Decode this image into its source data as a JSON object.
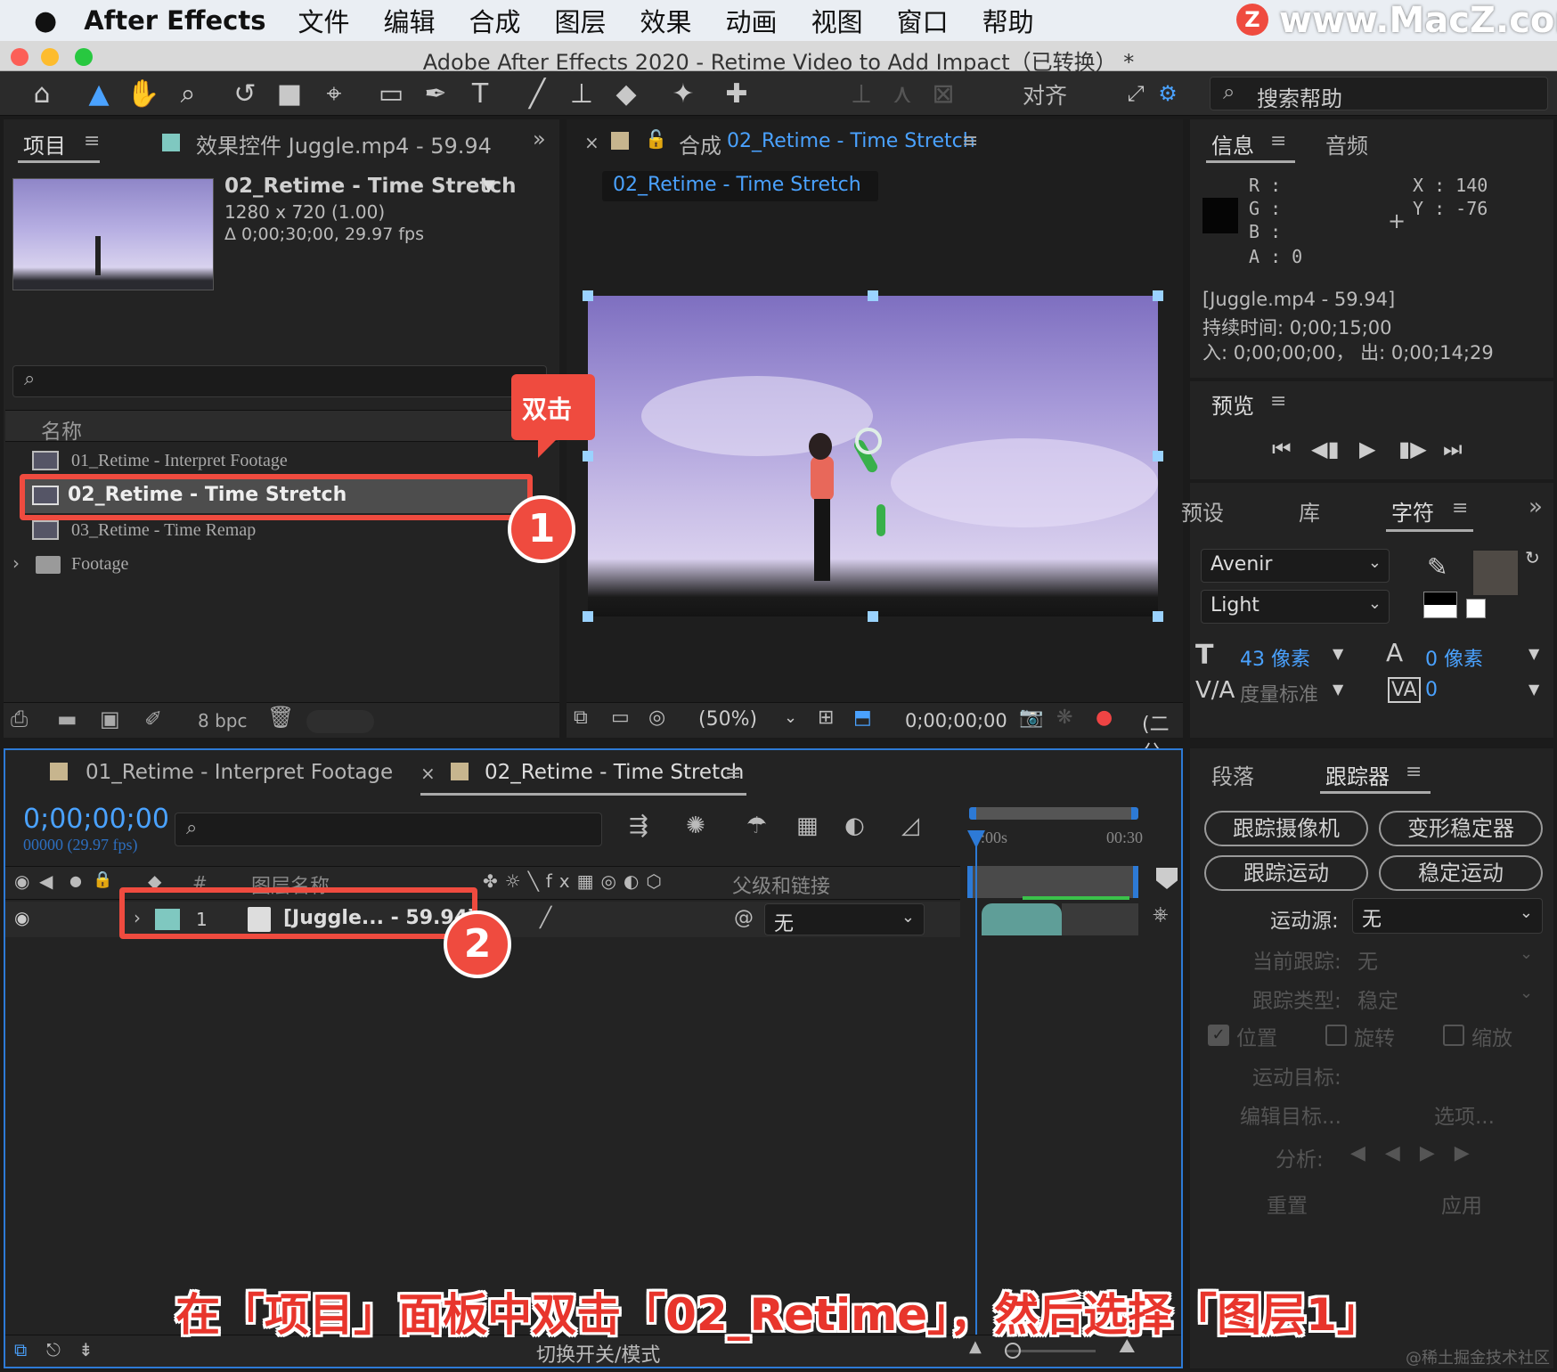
{
  "menubar": {
    "app_name": "After Effects",
    "items": [
      "文件",
      "编辑",
      "合成",
      "图层",
      "效果",
      "动画",
      "视图",
      "窗口",
      "帮助"
    ],
    "watermark": "www.MacZ.com"
  },
  "window": {
    "title": "Adobe After Effects 2020 - Retime Video to Add Impact（已转换） *"
  },
  "toolbar": {
    "align_label": "对齐",
    "search_help_placeholder": "搜索帮助"
  },
  "project_panel": {
    "tab_project": "项目",
    "tab_effects": "效果控件 Juggle.mp4 - 59.94",
    "comp_name": "02_Retime - Time Stretch",
    "comp_res": "1280 x 720 (1.00)",
    "comp_dur": "Δ 0;00;30;00, 29.97 fps",
    "column_name": "名称",
    "items": [
      {
        "label": "01_Retime - Interpret Footage"
      },
      {
        "label": "02_Retime - Time Stretch"
      },
      {
        "label": "03_Retime - Time Remap"
      },
      {
        "label": "Footage"
      }
    ],
    "bpc": "8 bpc"
  },
  "comp_panel": {
    "tab_prefix": "合成",
    "tab_name": "02_Retime - Time Stretch",
    "flow_tab": "02_Retime - Time Stretch",
    "zoom": "(50%)",
    "timecode": "0;00;00;00",
    "resolution": "(二分"
  },
  "info_panel": {
    "tab_info": "信息",
    "tab_audio": "音频",
    "r_label": "R :",
    "g_label": "G :",
    "b_label": "B :",
    "a_label": "A :  0",
    "x_label": "X : 140",
    "y_label": "Y : -76",
    "clip_name": "[Juggle.mp4 - 59.94]",
    "duration": "持续时间: 0;00;15;00",
    "in_out": "入: 0;00;00;00，  出: 0;00;14;29"
  },
  "preview_panel": {
    "title": "预览"
  },
  "character_panel": {
    "tab_presets": "预设",
    "tab_library": "库",
    "tab_character": "字符",
    "font_family": "Avenir",
    "font_style": "Light",
    "font_size": "43 像素",
    "leading": "0 像素",
    "kerning": "度量标准",
    "tracking": "0"
  },
  "timeline": {
    "tab_1": "01_Retime - Interpret Footage",
    "tab_2": "02_Retime - Time Stretch",
    "timecode": "0;00;00;00",
    "fps_line": "00000 (29.97 fps)",
    "col_layer_name": "图层名称",
    "col_hash": "#",
    "col_parent": "父级和链接",
    "layer_number": "1",
    "layer_name": "[Juggle... - 59.94]",
    "parent_value": "无",
    "ruler_start": "0:00s",
    "ruler_end": "00:30",
    "footer_toggle": "切换开关/模式"
  },
  "tracker_panel": {
    "tab_paragraph": "段落",
    "tab_tracker": "跟踪器",
    "btn_track_camera": "跟踪摄像机",
    "btn_warp_stabilizer": "变形稳定器",
    "btn_track_motion": "跟踪运动",
    "btn_stabilize_motion": "稳定运动",
    "motion_source_label": "运动源:",
    "motion_source_value": "无",
    "current_track_label": "当前跟踪:",
    "current_track_value": "无",
    "track_type_label": "跟踪类型:",
    "track_type_value": "稳定",
    "cb_position": "位置",
    "cb_rotation": "旋转",
    "cb_scale": "缩放",
    "motion_target": "运动目标:",
    "edit_target": "编辑目标...",
    "options": "选项...",
    "analyze": "分析:",
    "reset": "重置",
    "apply": "应用"
  },
  "annotations": {
    "callout_double_click": "双击",
    "step_1": "1",
    "step_2": "2",
    "caption": "在「项目」面板中双击「02_Retime」，然后选择「图层1」",
    "credit": "@稀土掘金技术社区"
  },
  "colors": {
    "accent_blue": "#4aa2ff",
    "annotation_red": "#ef4b3f",
    "layer_teal": "#7fc8c0",
    "caption_red": "#e8352c"
  }
}
